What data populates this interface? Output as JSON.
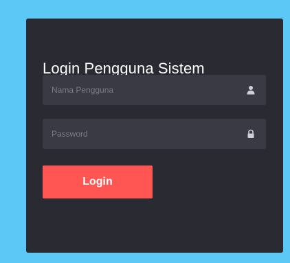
{
  "form": {
    "title": "Login Pengguna Sistem",
    "username": {
      "value": "",
      "placeholder": "Nama Pengguna",
      "icon": "user-icon"
    },
    "password": {
      "value": "",
      "placeholder": "Password",
      "icon": "lock-icon"
    },
    "login_label": "Login"
  },
  "colors": {
    "background": "#5bc8f5",
    "panel": "#2a2a33",
    "field": "#3a3a45",
    "button": "#ff5553",
    "icon": "#d0d0d6"
  }
}
